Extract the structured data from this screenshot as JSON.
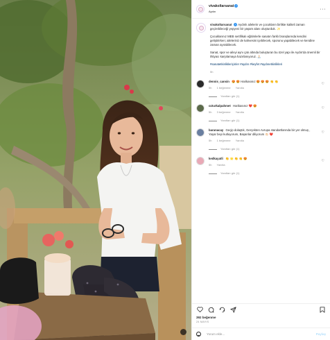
{
  "post": {
    "username": "vivakoltarsanat",
    "location": "Aydın",
    "caption": {
      "paragraph1": "Aydınlı ailelerin ve çocukların birlikte kaliteli zaman geçirebileceği yepyeni bir yaşam alanı oluşturduk. ✨",
      "paragraph2": "Çocuklarınız MEB sertifikalı eğitimlerle sanatın farklı branşlarında kendini geliştirirken; aileleriniz de kahvesini içebilecek, sporunu yapabilecek ve kendine zaman ayırabilecek.",
      "paragraph3": "Sanat, spor ve aileyi aynı çatı altında buluşturan bu özel yapı ile Aydın'da önemli bir ihtiyacı karşılamaya hazırlanıyoruz. 🙏🏻",
      "hashtags": "#sanatetkinlikleriçinler #aydın #keyfet #aydınetkinlikleri",
      "time": "5h"
    },
    "comments": [
      {
        "user": "dennis_cansin",
        "text": "😍 😍 Harikasınız 😍 😍 😍 👏 👏",
        "time": "5h",
        "likes": "1 beğenme",
        "reply": "Yanıtla",
        "replies": "Yanıtları gör (1)",
        "avatar_color": "#2a2a2a"
      },
      {
        "user": "ozturkalpahmet",
        "text": "Harikasınız ❤️ 😍",
        "time": "5h",
        "likes": "3 beğenme",
        "reply": "Yanıtla",
        "replies": "Yanıtları gör (1)",
        "avatar_color": "#5b6a4a"
      },
      {
        "user": "baranacay",
        "text": "Geçip dolaştık, Gerçekten Avrupa standartlarında bir yer olmuş , Yaşar beyi kutluyorum, Başarılar diliyorum 👏🏻 ❤️",
        "time": "5h",
        "likes": "1 beğenme",
        "reply": "Yanıtla",
        "replies": "Yanıtları gör (1)",
        "avatar_color": "#6a7fa0"
      },
      {
        "user": "kedkayatli",
        "text": "👏 🌟 👏 👏 😍",
        "time": "5h",
        "likes": "",
        "reply": "Yanıtla",
        "replies": "Yanıtları gör (1)",
        "avatar_color": "#e9a9b6"
      }
    ],
    "likes_count": "392 beğenme",
    "date": "24 MAYIS",
    "comment_placeholder": "Yorum ekle...",
    "post_button": "Paylaş"
  },
  "colors": {
    "link": "#00376b",
    "verified": "#3897f0",
    "muted": "#8e8e8e"
  }
}
